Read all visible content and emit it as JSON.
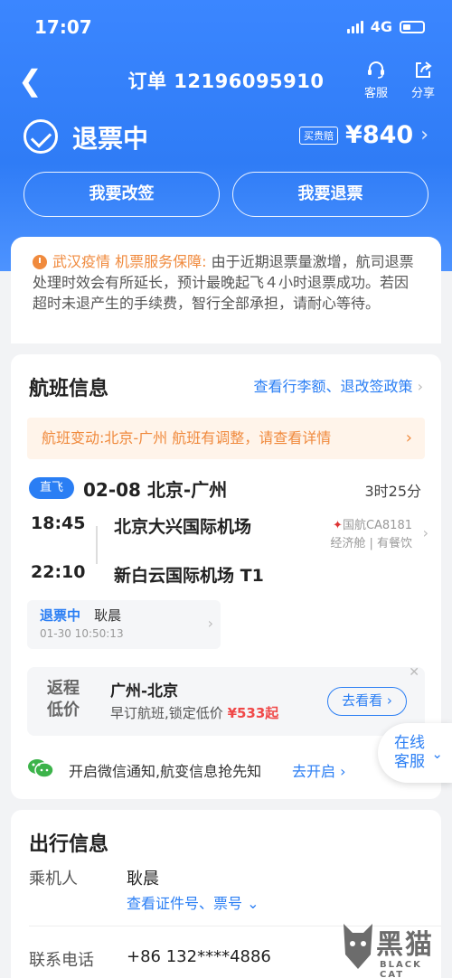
{
  "status_bar": {
    "time": "17:07",
    "network": "4G"
  },
  "navbar": {
    "title": "订单 12196095910",
    "service_label": "客服",
    "share_label": "分享"
  },
  "order": {
    "status": "退票中",
    "badge": "买贵赔",
    "price": "¥840"
  },
  "actions": {
    "change_label": "我要改签",
    "refund_label": "我要退票"
  },
  "notice": {
    "highlight": "武汉疫情 机票服务保障:",
    "text": " 由于近期退票量激增，航司退票处理时效会有所延长，预计最晚起飞４小时退票成功。若因超时未退产生的手续费，智行全部承担，请耐心等待。"
  },
  "flight": {
    "section_title": "航班信息",
    "policy_link": "查看行李额、退改签政策",
    "change_notice": "航班变动:北京-广州 航班有调整，请查看详情",
    "direct_tag": "直飞",
    "route_head": "02-08 北京-广州",
    "duration": "3时25分",
    "dep_time": "18:45",
    "dep_airport": "北京大兴国际机场",
    "arr_time": "22:10",
    "arr_airport": "新白云国际机场 T1",
    "airline": "国航CA8181",
    "cabin": "经济舱 | 有餐饮",
    "refund": {
      "status": "退票中",
      "name": "耿晨",
      "time": "01-30 10:50:13"
    }
  },
  "promo": {
    "tag_line1": "返程",
    "tag_line2": "低价",
    "route": "广州-北京",
    "desc": "早订航班,锁定低价",
    "price": "¥533起",
    "go_label": "去看看"
  },
  "wechat": {
    "text": "开启微信通知,航变信息抢先知",
    "link": "去开启"
  },
  "float_cs": {
    "line1": "在线",
    "line2": "客服"
  },
  "travel": {
    "section_title": "出行信息",
    "passenger_label": "乘机人",
    "passenger_name": "耿晨",
    "passenger_link": "查看证件号、票号",
    "phone_label": "联系电话",
    "phone_value": "+86 132****4886"
  },
  "watermark": {
    "line1": "黑猫",
    "line2": "BLACK CAT"
  },
  "colors": {
    "primary": "#2a7ef4",
    "header": "#3b86ff",
    "orange": "#f08a3d",
    "price_red": "#f04848"
  }
}
